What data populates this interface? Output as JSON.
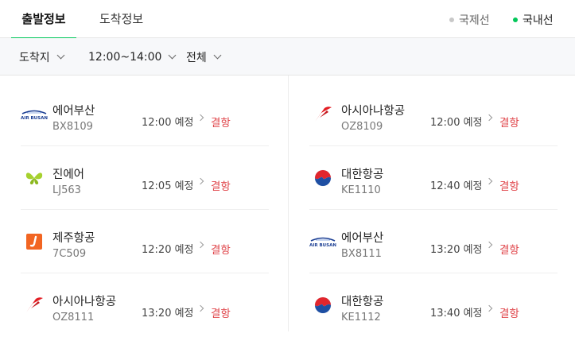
{
  "tabs": [
    {
      "label": "출발정보",
      "active": true
    },
    {
      "label": "도착정보",
      "active": false
    }
  ],
  "regions": [
    {
      "label": "국제선",
      "dot_color": "#c8c8c8",
      "selected": false
    },
    {
      "label": "국내선",
      "dot_color": "#03c75a",
      "selected": true
    }
  ],
  "filters": {
    "destination": "도착지",
    "time_range": "12:00~14:00",
    "scope": "전체"
  },
  "flights": {
    "left": [
      {
        "airline": "에어부산",
        "flight_no": "BX8109",
        "time": "12:00 예정",
        "status": "결항",
        "logo": "airbusan-logo-icon"
      },
      {
        "airline": "진에어",
        "flight_no": "LJ563",
        "time": "12:05 예정",
        "status": "결항",
        "logo": "jinair-logo-icon"
      },
      {
        "airline": "제주항공",
        "flight_no": "7C509",
        "time": "12:20 예정",
        "status": "결항",
        "logo": "jejuair-logo-icon"
      },
      {
        "airline": "아시아나항공",
        "flight_no": "OZ8111",
        "time": "13:20 예정",
        "status": "결항",
        "logo": "asiana-logo-icon"
      }
    ],
    "right": [
      {
        "airline": "아시아나항공",
        "flight_no": "OZ8109",
        "time": "12:00 예정",
        "status": "결항",
        "logo": "asiana-logo-icon"
      },
      {
        "airline": "대한항공",
        "flight_no": "KE1110",
        "time": "12:40 예정",
        "status": "결항",
        "logo": "koreanair-logo-icon"
      },
      {
        "airline": "에어부산",
        "flight_no": "BX8111",
        "time": "13:20 예정",
        "status": "결항",
        "logo": "airbusan-logo-icon"
      },
      {
        "airline": "대한항공",
        "flight_no": "KE1112",
        "time": "13:40 예정",
        "status": "결항",
        "logo": "koreanair-logo-icon"
      }
    ]
  },
  "colors": {
    "accent": "#03c75a",
    "status_cancelled": "#e0474c"
  }
}
